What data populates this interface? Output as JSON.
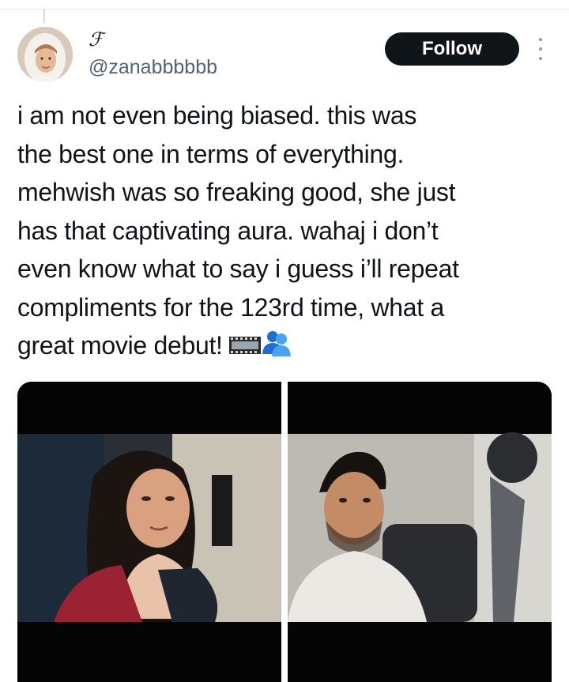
{
  "author": {
    "display_name": "ℱ",
    "handle": "@zanabbbbbb"
  },
  "follow_button": {
    "label": "Follow"
  },
  "more_menu": {
    "icon": "more-vertical-icon"
  },
  "tweet": {
    "text_lines": [
      "i am not even being biased. this was",
      "the best one in terms of everything.",
      "mehwish was so freaking good, she just",
      "has that captivating aura. wahaj i don’t",
      "even know what to say i guess i’ll repeat",
      "compliments for the 123rd time, what a",
      "great movie debut! "
    ],
    "emojis": [
      "film-frames-emoji",
      "two-people-emoji"
    ]
  },
  "media": [
    {
      "name": "movie-still-woman"
    },
    {
      "name": "movie-still-man"
    }
  ],
  "colors": {
    "text": "#0f1419",
    "secondary": "#536471",
    "button_bg": "#0f1419",
    "button_text": "#ffffff"
  }
}
